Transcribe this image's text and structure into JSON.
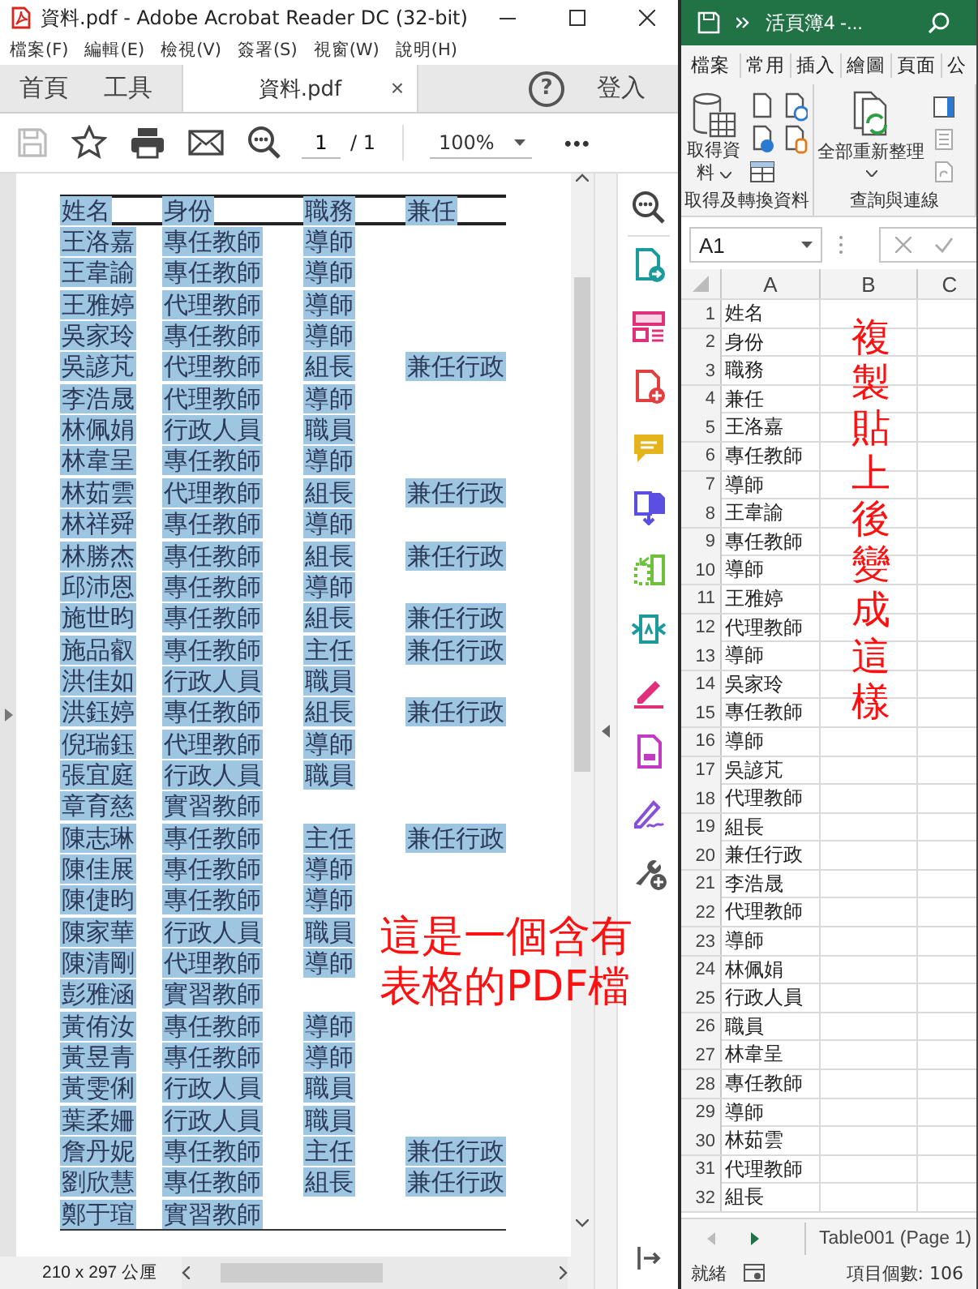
{
  "acrobat": {
    "title": "資料.pdf - Adobe Acrobat Reader DC (32-bit)",
    "menu": [
      "檔案(F)",
      "編輯(E)",
      "檢視(V)",
      "簽署(S)",
      "視窗(W)",
      "說明(H)"
    ],
    "tabs": [
      {
        "label": "首頁",
        "selected": false
      },
      {
        "label": "工具",
        "selected": false
      },
      {
        "label": "資料.pdf",
        "selected": true
      }
    ],
    "tab_close": "×",
    "help": "?",
    "sign_in": "登入",
    "toolbar": {
      "page": "1",
      "page_total": "/ 1",
      "zoom": "100%",
      "more": "•••"
    },
    "table": {
      "columns": [
        "姓名",
        "身份",
        "職務",
        "兼任"
      ],
      "rows": [
        [
          "王洛嘉",
          "專任教師",
          "導師"
        ],
        [
          "王韋諭",
          "專任教師",
          "導師"
        ],
        [
          "王雅婷",
          "代理教師",
          "導師"
        ],
        [
          "吳家玲",
          "專任教師",
          "導師"
        ],
        [
          "吳諺芃",
          "代理教師",
          "組長",
          "兼任行政"
        ],
        [
          "李浩晟",
          "代理教師",
          "導師"
        ],
        [
          "林佩娟",
          "行政人員",
          "職員"
        ],
        [
          "林韋呈",
          "專任教師",
          "導師"
        ],
        [
          "林茹雲",
          "代理教師",
          "組長",
          "兼任行政"
        ],
        [
          "林祥舜",
          "專任教師",
          "導師"
        ],
        [
          "林勝杰",
          "專任教師",
          "組長",
          "兼任行政"
        ],
        [
          "邱沛恩",
          "專任教師",
          "導師"
        ],
        [
          "施世昀",
          "專任教師",
          "組長",
          "兼任行政"
        ],
        [
          "施品叡",
          "專任教師",
          "主任",
          "兼任行政"
        ],
        [
          "洪佳如",
          "行政人員",
          "職員"
        ],
        [
          "洪鈺婷",
          "專任教師",
          "組長",
          "兼任行政"
        ],
        [
          "倪瑞鈺",
          "代理教師",
          "導師"
        ],
        [
          "張宜庭",
          "行政人員",
          "職員"
        ],
        [
          "章育慈",
          "實習教師"
        ],
        [
          "陳志琳",
          "專任教師",
          "主任",
          "兼任行政"
        ],
        [
          "陳佳展",
          "專任教師",
          "導師"
        ],
        [
          "陳倢昀",
          "專任教師",
          "導師"
        ],
        [
          "陳家華",
          "行政人員",
          "職員"
        ],
        [
          "陳清剛",
          "代理教師",
          "導師"
        ],
        [
          "彭雅涵",
          "實習教師"
        ],
        [
          "黃侑汝",
          "專任教師",
          "導師"
        ],
        [
          "黃昱青",
          "專任教師",
          "導師"
        ],
        [
          "黃雯俐",
          "行政人員",
          "職員"
        ],
        [
          "葉柔姍",
          "行政人員",
          "職員"
        ],
        [
          "詹丹妮",
          "專任教師",
          "主任",
          "兼任行政"
        ],
        [
          "劉欣慧",
          "專任教師",
          "組長",
          "兼任行政"
        ],
        [
          "鄭于瑄",
          "實習教師"
        ]
      ]
    },
    "annotation": [
      "這是一個含有",
      "表格的PDF檔"
    ],
    "page_size": "210 x 297 公厘"
  },
  "excel": {
    "title": "活頁簿4 -...",
    "ribbon_tabs": [
      "檔案",
      "常用",
      "插入",
      "繪圖",
      "頁面",
      "公"
    ],
    "groups": [
      {
        "label": "取得及轉換資料",
        "button": "取得資料"
      },
      {
        "label": "查詢與連線",
        "button": "全部重新整理"
      }
    ],
    "name_box": "A1",
    "columns": [
      "A",
      "B",
      "C"
    ],
    "rows": [
      [
        "1",
        "姓名"
      ],
      [
        "2",
        "身份"
      ],
      [
        "3",
        "職務"
      ],
      [
        "4",
        "兼任"
      ],
      [
        "5",
        "王洛嘉"
      ],
      [
        "6",
        "專任教師"
      ],
      [
        "7",
        "導師"
      ],
      [
        "8",
        "王韋諭"
      ],
      [
        "9",
        "專任教師"
      ],
      [
        "10",
        "導師"
      ],
      [
        "11",
        "王雅婷"
      ],
      [
        "12",
        "代理教師"
      ],
      [
        "13",
        "導師"
      ],
      [
        "14",
        "吳家玲"
      ],
      [
        "15",
        "專任教師"
      ],
      [
        "16",
        "導師"
      ],
      [
        "17",
        "吳諺芃"
      ],
      [
        "18",
        "代理教師"
      ],
      [
        "19",
        "組長"
      ],
      [
        "20",
        "兼任行政"
      ],
      [
        "21",
        "李浩晟"
      ],
      [
        "22",
        "代理教師"
      ],
      [
        "23",
        "導師"
      ],
      [
        "24",
        "林佩娟"
      ],
      [
        "25",
        "行政人員"
      ],
      [
        "26",
        "職員"
      ],
      [
        "27",
        "林韋呈"
      ],
      [
        "28",
        "專任教師"
      ],
      [
        "29",
        "導師"
      ],
      [
        "30",
        "林茹雲"
      ],
      [
        "31",
        "代理教師"
      ],
      [
        "32",
        "組長"
      ]
    ],
    "annotation": "複製貼上後變成這樣",
    "sheet_tab": "Table001 (Page 1)",
    "status": "就緒",
    "count": "項目個數: 106"
  }
}
